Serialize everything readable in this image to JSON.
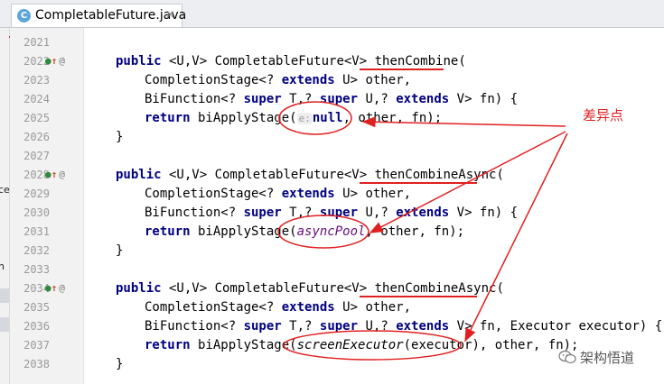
{
  "tab": {
    "title": "CompletableFuture.java",
    "icon_letter": "C",
    "close_glyph": "×"
  },
  "left_strip": {
    "frag1": "ce",
    "frag2": "n"
  },
  "line_numbers": [
    "2021",
    "2022",
    "2023",
    "2024",
    "2025",
    "2026",
    "2027",
    "2028",
    "2029",
    "2030",
    "2031",
    "2032",
    "2033",
    "2034",
    "2035",
    "2036",
    "2037",
    "2038"
  ],
  "gutter_icons": {
    "impl": "●",
    "override": "↑",
    "annotation": "@"
  },
  "code": {
    "public": "public",
    "extends": "extends",
    "super": "super",
    "return": "return",
    "null": "null",
    "m1": {
      "generic_sig": " <U,V> CompletableFuture<V> ",
      "name": "thenCombine",
      "paren": "(",
      "p1_type": "CompletionStage<? ",
      "p1_tail": " U> other,",
      "p2_type": "BiFunction<? ",
      "p2_mid1": " T,? ",
      "p2_mid2": " U,? ",
      "p2_tail": " V> fn) {",
      "call": " biApplyStage(",
      "hint": "e:",
      "args_tail": ", other, fn);",
      "close": "}"
    },
    "m2": {
      "generic_sig": " <U,V> CompletableFuture<V> ",
      "name": "thenCombineAsync",
      "paren": "(",
      "p1_type": "CompletionStage<? ",
      "p1_tail": " U> other,",
      "p2_type": "BiFunction<? ",
      "p2_mid1": " T,? ",
      "p2_mid2": " U,? ",
      "p2_tail": " V> fn) {",
      "call": " biApplyStage(",
      "arg": "asyncPool",
      "args_tail": ", other, fn);",
      "close": "}"
    },
    "m3": {
      "generic_sig": " <U,V> CompletableFuture<V> ",
      "name": "thenCombineAsync",
      "paren": "(",
      "p1_type": "CompletionStage<? ",
      "p1_tail": " U> other,",
      "p2_type": "BiFunction<? ",
      "p2_mid1": " T,? ",
      "p2_mid2": " U,? ",
      "p2_tail": " V> fn, Executor executor) {",
      "call": " biApplyStage(",
      "arg": "screenExecutor",
      "arg_rest": "(executor)",
      "args_tail": ", other, fn);",
      "close": "}"
    }
  },
  "annotation": {
    "text": "差异点",
    "color": "#e02020"
  },
  "watermark": {
    "text": "架构悟道"
  },
  "colors": {
    "keyword": "#000080",
    "type_param": "#20999d",
    "italic_field": "#660e7a",
    "markup": "#e02020"
  }
}
